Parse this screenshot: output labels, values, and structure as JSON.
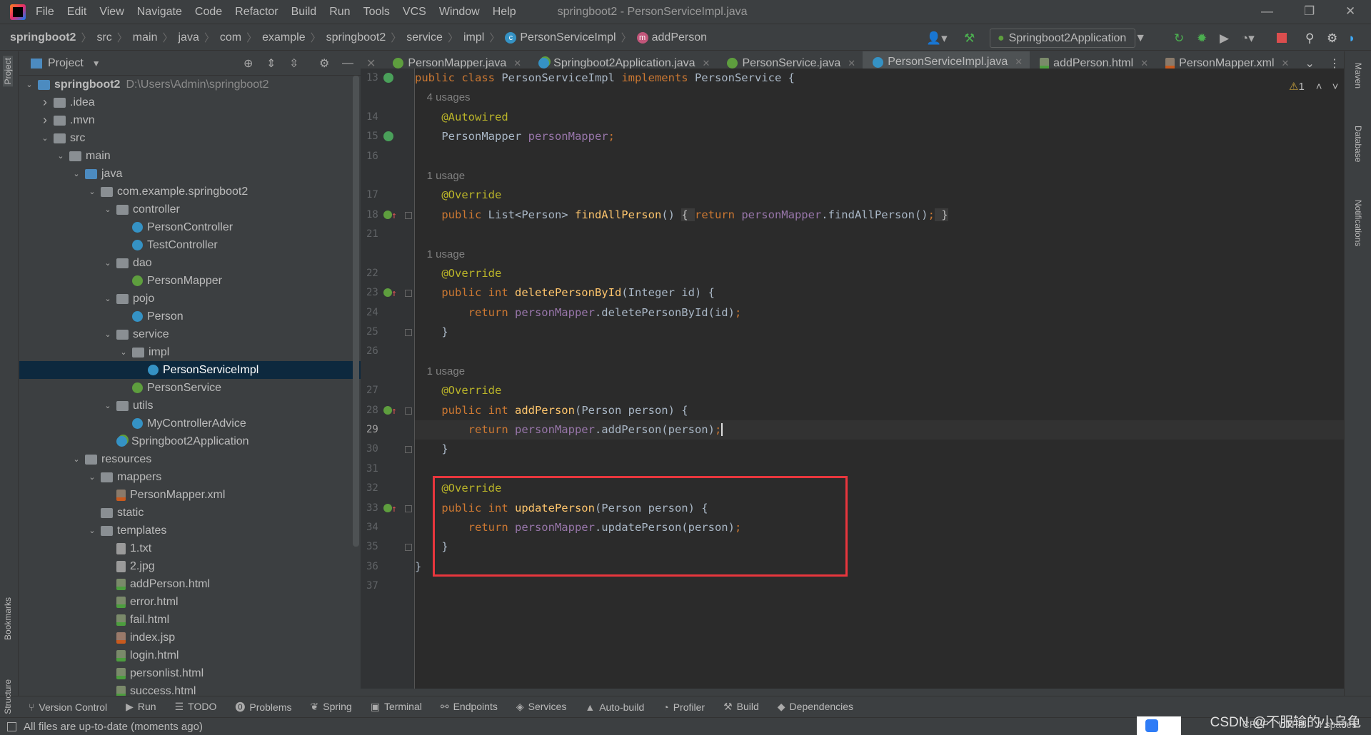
{
  "window": {
    "title": "springboot2 - PersonServiceImpl.java",
    "menu": [
      "File",
      "Edit",
      "View",
      "Navigate",
      "Code",
      "Refactor",
      "Build",
      "Run",
      "Tools",
      "VCS",
      "Window",
      "Help"
    ]
  },
  "breadcrumb": [
    "springboot2",
    "src",
    "main",
    "java",
    "com",
    "example",
    "springboot2",
    "service",
    "impl",
    "PersonServiceImpl",
    "addPerson"
  ],
  "run_config": "Springboot2Application",
  "project": {
    "label": "Project",
    "tree": [
      {
        "level": 0,
        "arrow": "v",
        "icon": "module",
        "label": "springboot2",
        "path": "D:\\Users\\Admin\\springboot2",
        "bold": true
      },
      {
        "level": 1,
        "arrow": ">",
        "icon": "folder",
        "label": ".idea"
      },
      {
        "level": 1,
        "arrow": ">",
        "icon": "folder",
        "label": ".mvn"
      },
      {
        "level": 1,
        "arrow": "v",
        "icon": "folder",
        "label": "src"
      },
      {
        "level": 2,
        "arrow": "v",
        "icon": "folder",
        "label": "main"
      },
      {
        "level": 3,
        "arrow": "v",
        "icon": "src",
        "label": "java"
      },
      {
        "level": 4,
        "arrow": "v",
        "icon": "folder",
        "label": "com.example.springboot2"
      },
      {
        "level": 5,
        "arrow": "v",
        "icon": "folder",
        "label": "controller"
      },
      {
        "level": 6,
        "arrow": "",
        "icon": "class",
        "label": "PersonController"
      },
      {
        "level": 6,
        "arrow": "",
        "icon": "class",
        "label": "TestController"
      },
      {
        "level": 5,
        "arrow": "v",
        "icon": "folder",
        "label": "dao"
      },
      {
        "level": 6,
        "arrow": "",
        "icon": "int",
        "label": "PersonMapper"
      },
      {
        "level": 5,
        "arrow": "v",
        "icon": "folder",
        "label": "pojo"
      },
      {
        "level": 6,
        "arrow": "",
        "icon": "class",
        "label": "Person"
      },
      {
        "level": 5,
        "arrow": "v",
        "icon": "folder",
        "label": "service"
      },
      {
        "level": 6,
        "arrow": "v",
        "icon": "folder",
        "label": "impl"
      },
      {
        "level": 7,
        "arrow": "",
        "icon": "class",
        "label": "PersonServiceImpl",
        "selected": true
      },
      {
        "level": 6,
        "arrow": "",
        "icon": "int",
        "label": "PersonService"
      },
      {
        "level": 5,
        "arrow": "v",
        "icon": "folder",
        "label": "utils"
      },
      {
        "level": 6,
        "arrow": "",
        "icon": "class",
        "label": "MyControllerAdvice"
      },
      {
        "level": 5,
        "arrow": "",
        "icon": "app",
        "label": "Springboot2Application"
      },
      {
        "level": 3,
        "arrow": "v",
        "icon": "res",
        "label": "resources"
      },
      {
        "level": 4,
        "arrow": "v",
        "icon": "folder",
        "label": "mappers"
      },
      {
        "level": 5,
        "arrow": "",
        "icon": "xml",
        "label": "PersonMapper.xml"
      },
      {
        "level": 4,
        "arrow": "",
        "icon": "folder",
        "label": "static"
      },
      {
        "level": 4,
        "arrow": "v",
        "icon": "folder",
        "label": "templates"
      },
      {
        "level": 5,
        "arrow": "",
        "icon": "txt",
        "label": "1.txt"
      },
      {
        "level": 5,
        "arrow": "",
        "icon": "txt",
        "label": "2.jpg"
      },
      {
        "level": 5,
        "arrow": "",
        "icon": "html",
        "label": "addPerson.html"
      },
      {
        "level": 5,
        "arrow": "",
        "icon": "html",
        "label": "error.html"
      },
      {
        "level": 5,
        "arrow": "",
        "icon": "html",
        "label": "fail.html"
      },
      {
        "level": 5,
        "arrow": "",
        "icon": "jsp",
        "label": "index.jsp"
      },
      {
        "level": 5,
        "arrow": "",
        "icon": "html",
        "label": "login.html"
      },
      {
        "level": 5,
        "arrow": "",
        "icon": "html",
        "label": "personlist.html"
      },
      {
        "level": 5,
        "arrow": "",
        "icon": "html",
        "label": "success.html"
      }
    ]
  },
  "tabs": [
    {
      "label": "PersonMapper.java",
      "icon": "int"
    },
    {
      "label": "Springboot2Application.java",
      "icon": "app"
    },
    {
      "label": "PersonService.java",
      "icon": "int"
    },
    {
      "label": "PersonServiceImpl.java",
      "icon": "class",
      "active": true
    },
    {
      "label": "addPerson.html",
      "icon": "html"
    },
    {
      "label": "PersonMapper.xml",
      "icon": "xml"
    }
  ],
  "inspection": "1",
  "code": [
    {
      "n": "13",
      "mark": "bean",
      "tokens": [
        [
          "k",
          "public class "
        ],
        [
          "t",
          "PersonServiceImpl "
        ],
        [
          "k",
          "implements "
        ],
        [
          "t",
          "PersonService {"
        ]
      ]
    },
    {
      "n": "",
      "tokens": [
        [
          "h",
          "    4 usages"
        ]
      ]
    },
    {
      "n": "14",
      "tokens": [
        [
          "a",
          "    @Autowired"
        ]
      ]
    },
    {
      "n": "15",
      "mark": "bean",
      "tokens": [
        [
          "t",
          "    PersonMapper "
        ],
        [
          "p",
          "personMapper"
        ],
        [
          "k",
          ";"
        ]
      ]
    },
    {
      "n": "16",
      "tokens": []
    },
    {
      "n": "",
      "tokens": [
        [
          "h",
          "    1 usage"
        ]
      ]
    },
    {
      "n": "17",
      "tokens": [
        [
          "a",
          "    @Override"
        ]
      ]
    },
    {
      "n": "18",
      "mark": "impl",
      "fold": true,
      "tokens": [
        [
          "k",
          "    public "
        ],
        [
          "t",
          "List<Person> "
        ],
        [
          "f",
          "findAllPerson"
        ],
        [
          "t",
          "() "
        ],
        [
          "bx",
          "{ "
        ],
        [
          "k",
          "return "
        ],
        [
          "p",
          "personMapper"
        ],
        [
          "t",
          ".findAllPerson()"
        ],
        [
          "k",
          ";"
        ],
        [
          "bx",
          " }"
        ]
      ]
    },
    {
      "n": "21",
      "tokens": []
    },
    {
      "n": "",
      "tokens": [
        [
          "h",
          "    1 usage"
        ]
      ]
    },
    {
      "n": "22",
      "tokens": [
        [
          "a",
          "    @Override"
        ]
      ]
    },
    {
      "n": "23",
      "mark": "impl",
      "fold": true,
      "tokens": [
        [
          "k",
          "    public int "
        ],
        [
          "f",
          "deletePersonById"
        ],
        [
          "t",
          "(Integer id) {"
        ]
      ]
    },
    {
      "n": "24",
      "tokens": [
        [
          "k",
          "        return "
        ],
        [
          "p",
          "personMapper"
        ],
        [
          "t",
          ".deletePersonById(id)"
        ],
        [
          "k",
          ";"
        ]
      ]
    },
    {
      "n": "25",
      "fold": true,
      "tokens": [
        [
          "t",
          "    }"
        ]
      ]
    },
    {
      "n": "26",
      "tokens": []
    },
    {
      "n": "",
      "tokens": [
        [
          "h",
          "    1 usage"
        ]
      ]
    },
    {
      "n": "27",
      "tokens": [
        [
          "a",
          "    @Override"
        ]
      ]
    },
    {
      "n": "28",
      "mark": "impl",
      "fold": true,
      "tokens": [
        [
          "k",
          "    public int "
        ],
        [
          "f",
          "addPerson"
        ],
        [
          "t",
          "(Person person) {"
        ]
      ]
    },
    {
      "n": "29",
      "current": true,
      "tokens": [
        [
          "k",
          "        return "
        ],
        [
          "p",
          "personMapper"
        ],
        [
          "t",
          ".addPerson(person)"
        ],
        [
          "k",
          ";"
        ]
      ]
    },
    {
      "n": "30",
      "fold": true,
      "tokens": [
        [
          "t",
          "    }"
        ]
      ]
    },
    {
      "n": "31",
      "tokens": []
    },
    {
      "n": "32",
      "tokens": [
        [
          "a",
          "    @Override"
        ]
      ]
    },
    {
      "n": "33",
      "mark": "impl",
      "fold": true,
      "tokens": [
        [
          "k",
          "    public int "
        ],
        [
          "f",
          "updatePerson"
        ],
        [
          "t",
          "(Person person) {"
        ]
      ]
    },
    {
      "n": "34",
      "tokens": [
        [
          "k",
          "        return "
        ],
        [
          "p",
          "personMapper"
        ],
        [
          "t",
          ".updatePerson(person)"
        ],
        [
          "k",
          ";"
        ]
      ]
    },
    {
      "n": "35",
      "fold": true,
      "tokens": [
        [
          "t",
          "    }"
        ]
      ]
    },
    {
      "n": "36",
      "tokens": [
        [
          "t",
          "}"
        ]
      ]
    },
    {
      "n": "37",
      "tokens": []
    }
  ],
  "right_stripe": [
    "Maven",
    "Database",
    "Notifications"
  ],
  "left_stripe": [
    "Project",
    "Bookmarks",
    "Structure"
  ],
  "toolwindows": [
    "Version Control",
    "Run",
    "TODO",
    "Problems",
    "Spring",
    "Terminal",
    "Endpoints",
    "Services",
    "Auto-build",
    "Profiler",
    "Build",
    "Dependencies"
  ],
  "status": {
    "message": "All files are up-to-date (moments ago)",
    "line_sep": "CRLF",
    "encoding": "UTF-8",
    "indent": "4 spaces"
  },
  "watermark": "CSDN @不服输的小乌龟",
  "colors": {
    "highlight_box": "#e8363d",
    "accent": "#4a88c7"
  }
}
